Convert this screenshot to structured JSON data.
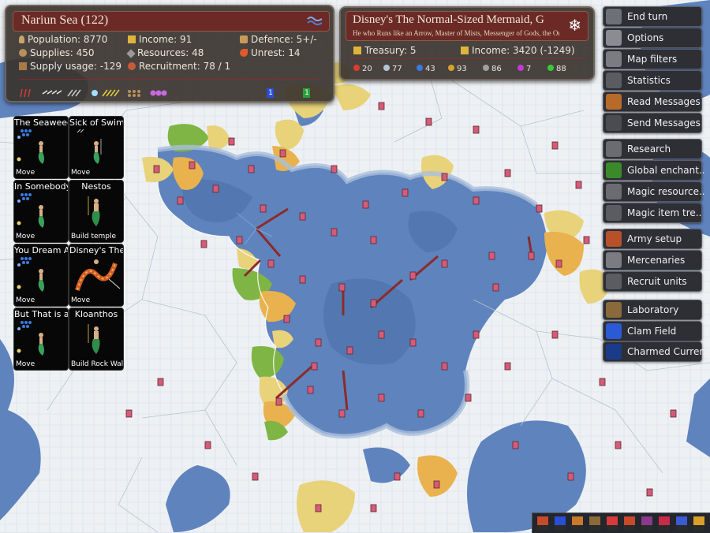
{
  "province": {
    "name": "Nariun Sea (122)",
    "population": "Population: 8770",
    "income": "Income: 91",
    "defence": "Defence: 5+/-",
    "supplies": "Supplies: 450",
    "resources": "Resources: 48",
    "unrest": "Unrest: 14",
    "supply_usage": "Supply usage: -129",
    "recruitment": "Recruitment: 78 / 1",
    "badge_a": "1",
    "badge_b": "1"
  },
  "nation": {
    "name": "Disney's The Normal-Sized Mermaid, G",
    "subtitle": "He who Runs like an Arrow, Master of Mists, Messenger of Gods, the On",
    "treasury": "Treasury: 5",
    "income": "Income: 3420 (-1249)",
    "gems": [
      {
        "value": "20",
        "color": "#e23a2a"
      },
      {
        "value": "77",
        "color": "#b8c4d4"
      },
      {
        "value": "43",
        "color": "#3a7be0"
      },
      {
        "value": "93",
        "color": "#d8a12a"
      },
      {
        "value": "86",
        "color": "#a0a0a0"
      },
      {
        "value": "7",
        "color": "#c23ad8"
      },
      {
        "value": "88",
        "color": "#3ac83a"
      }
    ]
  },
  "commands": [
    {
      "label": "End turn",
      "icon": "end-turn-icon"
    },
    {
      "label": "Options",
      "icon": "options-icon"
    },
    {
      "label": "Map filters",
      "icon": "map-filters-icon"
    },
    {
      "label": "Statistics",
      "icon": "statistics-icon"
    },
    {
      "label": "Read Messages",
      "icon": "read-messages-icon"
    },
    {
      "label": "Send Messages",
      "icon": "send-messages-icon"
    },
    {
      "label": "Research",
      "icon": "research-icon"
    },
    {
      "label": "Global enchant..",
      "icon": "global-enchant-icon"
    },
    {
      "label": "Magic resource..",
      "icon": "magic-resource-icon"
    },
    {
      "label": "Magic item tre..",
      "icon": "magic-item-icon"
    },
    {
      "label": "Army setup",
      "icon": "army-setup-icon"
    },
    {
      "label": "Mercenaries",
      "icon": "mercenaries-icon"
    },
    {
      "label": "Recruit units",
      "icon": "recruit-units-icon"
    },
    {
      "label": "Laboratory",
      "icon": "laboratory-icon"
    },
    {
      "label": "Clam Field",
      "icon": "clam-field-icon"
    },
    {
      "label": "Charmed Current",
      "icon": "charmed-current-icon"
    }
  ],
  "units": [
    {
      "name": "The Seaweed",
      "order": "Move"
    },
    {
      "name": "Sick of Swim",
      "order": "Move"
    },
    {
      "name": "In Somebody",
      "order": "Move"
    },
    {
      "name": "Nestos",
      "order": "Build temple"
    },
    {
      "name": "You Dream A",
      "order": "Move"
    },
    {
      "name": "Disney's The",
      "order": "Move"
    },
    {
      "name": "But That is a",
      "order": "Move"
    },
    {
      "name": "Kloanthos",
      "order": "Build Rock Wall"
    }
  ],
  "colors": {
    "sea_deep": "#5f83bd",
    "sea_shallow": "#a9bfdc",
    "snow_land": "#eef1f4",
    "yellow_land": "#e8d27a",
    "green_land": "#7fb544",
    "orange_land": "#e9b24e",
    "panel_title": "#6b2a25"
  }
}
